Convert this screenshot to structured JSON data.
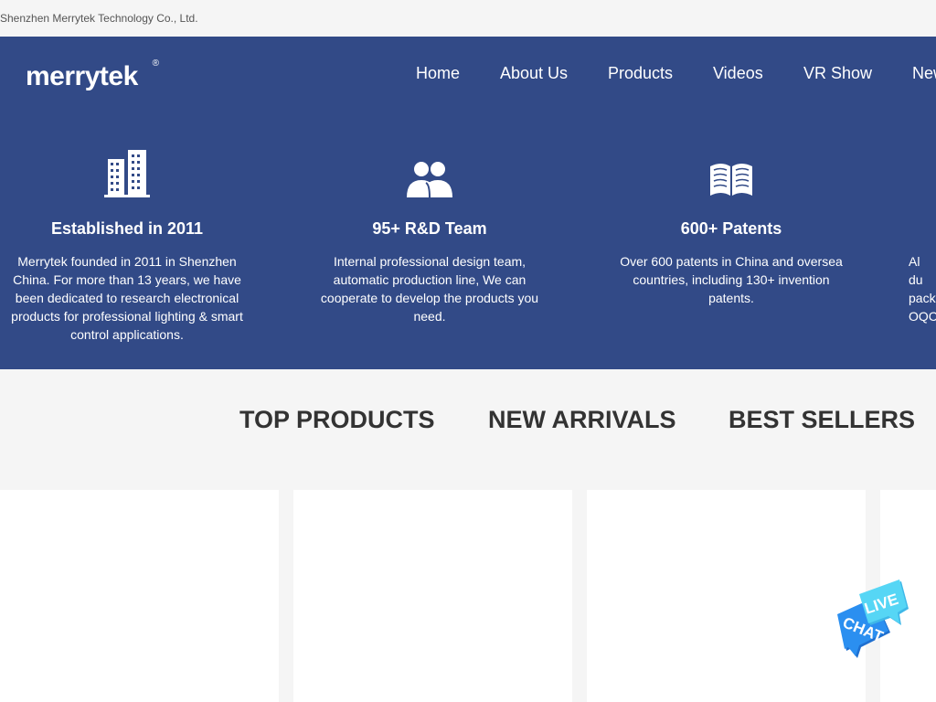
{
  "header": {
    "company_name": "Shenzhen Merrytek Technology Co., Ltd."
  },
  "brand": {
    "logo_text": "merrytek",
    "registered_mark": "®",
    "logo_icon": "merrytek-logo-icon"
  },
  "nav": {
    "items": [
      {
        "label": "Home"
      },
      {
        "label": "About Us"
      },
      {
        "label": "Products"
      },
      {
        "label": "Videos"
      },
      {
        "label": "VR Show"
      },
      {
        "label": "News"
      }
    ]
  },
  "features": [
    {
      "icon": "building-icon",
      "title": "Established in 2011",
      "description": "Merrytek founded in 2011 in Shenzhen China. For more than 13 years, we have been dedicated to research electronical products for professional lighting & smart control applications."
    },
    {
      "icon": "team-icon",
      "title": "95+ R&D Team",
      "description": "Internal professional design team, automatic production line, We can cooperate to develop the products you need."
    },
    {
      "icon": "book-icon",
      "title": "600+ Patents",
      "description": "Over 600 patents in China and oversea countries, including 130+ invention patents."
    },
    {
      "icon": "quality-icon",
      "title": "",
      "description": "Al du pack OQC"
    }
  ],
  "product_tabs": [
    {
      "label": "TOP PRODUCTS"
    },
    {
      "label": "NEW ARRIVALS"
    },
    {
      "label": "BEST SELLERS"
    }
  ],
  "live_chat": {
    "line1": "LIVE",
    "line2": "CHAT",
    "icon": "live-chat-icon"
  },
  "colors": {
    "hero_bg": "#324a87",
    "page_bg": "#f5f5f5",
    "chat_blue": "#2b8ff0",
    "chat_cyan": "#56d6f5"
  }
}
